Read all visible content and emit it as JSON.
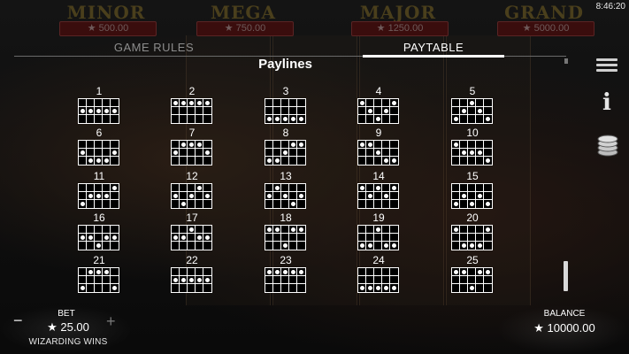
{
  "clock": "8:46:20",
  "jackpots": [
    {
      "name": "MINOR",
      "value": "★ 500.00"
    },
    {
      "name": "MEGA",
      "value": "★ 750.00"
    },
    {
      "name": "MAJOR",
      "value": "★ 1250.00"
    },
    {
      "name": "GRAND",
      "value": "★ 5000.00"
    }
  ],
  "tabs": {
    "rules": "GAME RULES",
    "paytable": "PAYTABLE"
  },
  "title": "Paylines",
  "paylines": [
    {
      "n": "1",
      "rows": [
        1,
        1,
        1,
        1,
        1
      ]
    },
    {
      "n": "2",
      "rows": [
        0,
        0,
        0,
        0,
        0
      ]
    },
    {
      "n": "3",
      "rows": [
        2,
        2,
        2,
        2,
        2
      ]
    },
    {
      "n": "4",
      "rows": [
        0,
        1,
        2,
        1,
        0
      ]
    },
    {
      "n": "5",
      "rows": [
        2,
        1,
        0,
        1,
        2
      ]
    },
    {
      "n": "6",
      "rows": [
        1,
        2,
        2,
        2,
        1
      ]
    },
    {
      "n": "7",
      "rows": [
        1,
        0,
        0,
        0,
        1
      ]
    },
    {
      "n": "8",
      "rows": [
        2,
        2,
        1,
        0,
        0
      ]
    },
    {
      "n": "9",
      "rows": [
        0,
        0,
        1,
        2,
        2
      ]
    },
    {
      "n": "10",
      "rows": [
        0,
        1,
        1,
        1,
        2
      ]
    },
    {
      "n": "11",
      "rows": [
        2,
        1,
        1,
        1,
        0
      ]
    },
    {
      "n": "12",
      "rows": [
        1,
        2,
        1,
        0,
        1
      ]
    },
    {
      "n": "13",
      "rows": [
        1,
        0,
        1,
        2,
        1
      ]
    },
    {
      "n": "14",
      "rows": [
        0,
        1,
        0,
        1,
        0
      ]
    },
    {
      "n": "15",
      "rows": [
        2,
        1,
        2,
        1,
        2
      ]
    },
    {
      "n": "16",
      "rows": [
        1,
        1,
        2,
        1,
        1
      ]
    },
    {
      "n": "17",
      "rows": [
        1,
        1,
        0,
        1,
        1
      ]
    },
    {
      "n": "18",
      "rows": [
        0,
        0,
        2,
        0,
        0
      ]
    },
    {
      "n": "19",
      "rows": [
        2,
        2,
        0,
        2,
        2
      ]
    },
    {
      "n": "20",
      "rows": [
        0,
        2,
        2,
        2,
        0
      ]
    },
    {
      "n": "21",
      "rows": [
        2,
        0,
        0,
        0,
        2
      ]
    },
    {
      "n": "22",
      "rows": [
        1,
        1,
        1,
        1,
        1
      ]
    },
    {
      "n": "23",
      "rows": [
        0,
        0,
        0,
        0,
        0
      ]
    },
    {
      "n": "24",
      "rows": [
        2,
        2,
        2,
        2,
        2
      ]
    },
    {
      "n": "25",
      "rows": [
        0,
        0,
        2,
        0,
        0
      ]
    }
  ],
  "bet": {
    "label": "BET",
    "value": "★ 25.00",
    "minus": "−",
    "plus": "+"
  },
  "game_name": "WIZARDING WINS",
  "balance": {
    "label": "BALANCE",
    "value": "★ 10000.00"
  },
  "icons": {
    "menu": "menu-icon",
    "info": "info-icon",
    "coins": "coins-icon"
  }
}
